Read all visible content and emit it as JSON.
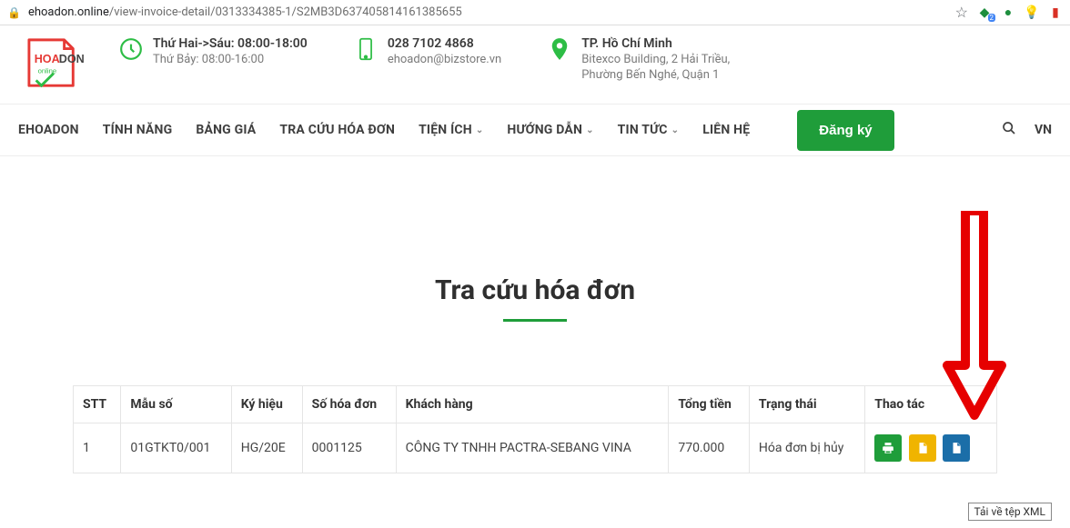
{
  "browser": {
    "url_domain": "ehoadon.online",
    "url_path": "/view-invoice-detail/0313334385-1/S2MB3D637405814161385655",
    "extensions_badge": "2"
  },
  "topbar": {
    "logo_text_top": "HOA DON",
    "logo_text_bottom": "online",
    "time": {
      "line1": "Thứ Hai->Sáu: 08:00-18:00",
      "line2": "Thứ Bảy: 08:00-16:00"
    },
    "phone": {
      "line1": "028 7102 4868",
      "line2": "ehoadon@bizstore.vn"
    },
    "address": {
      "line1": "TP. Hồ Chí Minh",
      "line2": "Bitexco Building, 2 Hải Triều,",
      "line3": "Phường Bến Nghé, Quận 1"
    }
  },
  "nav": {
    "items": [
      {
        "label": "EHOADON",
        "chev": false
      },
      {
        "label": "TÍNH NĂNG",
        "chev": false
      },
      {
        "label": "BẢNG GIÁ",
        "chev": false
      },
      {
        "label": "TRA CỨU HÓA ĐƠN",
        "chev": false
      },
      {
        "label": "TIỆN ÍCH",
        "chev": true
      },
      {
        "label": "HƯỚNG DẪN",
        "chev": true
      },
      {
        "label": "TIN TỨC",
        "chev": true
      },
      {
        "label": "LIÊN HỆ",
        "chev": false
      }
    ],
    "register": "Đăng ký",
    "lang": "VN"
  },
  "page": {
    "title": "Tra cứu hóa đơn"
  },
  "table": {
    "headers": {
      "stt": "STT",
      "mau_so": "Mẫu số",
      "ky_hieu": "Ký hiệu",
      "so_hd": "Số hóa đơn",
      "khach_hang": "Khách hàng",
      "tong_tien": "Tổng tiền",
      "trang_thai": "Trạng thái",
      "thao_tac": "Thao tác"
    },
    "rows": [
      {
        "stt": "1",
        "mau_so": "01GTKT0/001",
        "ky_hieu": "HG/20E",
        "so_hd": "0001125",
        "khach_hang": "CÔNG TY TNHH PACTRA-SEBANG VINA",
        "tong_tien": "770.000",
        "trang_thai": "Hóa đơn bị hủy"
      }
    ]
  },
  "tooltip": "Tải về tệp XML"
}
